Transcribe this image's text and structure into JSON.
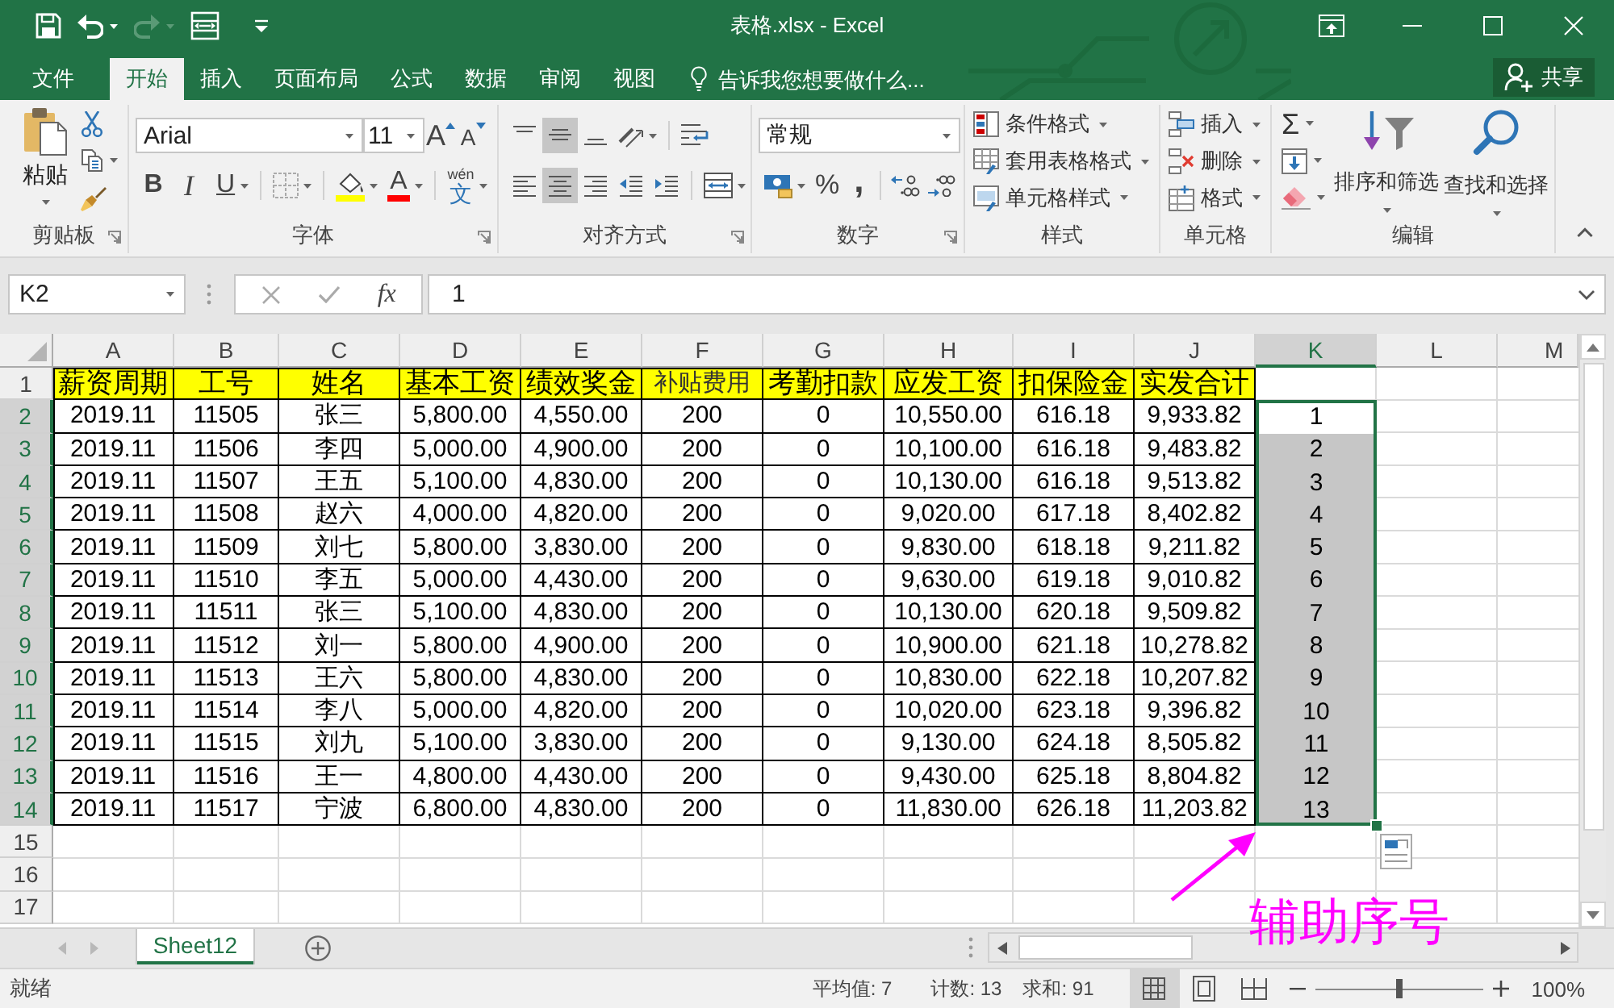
{
  "title_bar": {
    "title": "表格.xlsx - Excel"
  },
  "ribbon_tabs": [
    {
      "label": "文件",
      "selected": false
    },
    {
      "label": "开始",
      "selected": true
    },
    {
      "label": "插入",
      "selected": false
    },
    {
      "label": "页面布局",
      "selected": false
    },
    {
      "label": "公式",
      "selected": false
    },
    {
      "label": "数据",
      "selected": false
    },
    {
      "label": "审阅",
      "selected": false
    },
    {
      "label": "视图",
      "selected": false
    }
  ],
  "tell_me": {
    "placeholder": "告诉我您想要做什么..."
  },
  "share_button": {
    "label": "共享"
  },
  "clipboard": {
    "paste": "粘贴",
    "group_label": "剪贴板"
  },
  "font": {
    "font_name": "Arial",
    "font_size": "11",
    "grow": "A",
    "shrink": "A",
    "bold": "B",
    "italic": "I",
    "underline": "U",
    "font_color": "A",
    "phonetic_hint": "wén",
    "phonetic": "文",
    "group_label": "字体"
  },
  "alignment": {
    "vertical": [
      {
        "kind": "top",
        "selected": false
      },
      {
        "kind": "middle",
        "selected": true
      },
      {
        "kind": "bottom",
        "selected": false
      }
    ],
    "horizontal": [
      {
        "kind": "left",
        "selected": false
      },
      {
        "kind": "center",
        "selected": true
      },
      {
        "kind": "right",
        "selected": false
      }
    ],
    "group_label": "对齐方式"
  },
  "number": {
    "format": "常规",
    "percent": "%",
    "comma": ",",
    "group_label": "数字"
  },
  "styles": {
    "items": [
      {
        "kind": "conditional",
        "label": "条件格式"
      },
      {
        "kind": "table",
        "label": "套用表格格式"
      },
      {
        "kind": "cell",
        "label": "单元格样式"
      }
    ],
    "group_label": "样式"
  },
  "cells": {
    "items": [
      {
        "kind": "insert",
        "label": "插入"
      },
      {
        "kind": "delete",
        "label": "删除"
      },
      {
        "kind": "format",
        "label": "格式"
      }
    ],
    "group_label": "单元格"
  },
  "editing": {
    "sum": "Σ",
    "sort": "排序和筛选",
    "find": "查找和选择",
    "group_label": "编辑"
  },
  "formula_bar": {
    "name_box": "K2",
    "function_label": "fx",
    "value": "1"
  },
  "sheet": {
    "columns": [
      {
        "label": "A",
        "selected": false
      },
      {
        "label": "B",
        "selected": false
      },
      {
        "label": "C",
        "selected": false
      },
      {
        "label": "D",
        "selected": false
      },
      {
        "label": "E",
        "selected": false
      },
      {
        "label": "F",
        "selected": false
      },
      {
        "label": "G",
        "selected": false
      },
      {
        "label": "H",
        "selected": false
      },
      {
        "label": "I",
        "selected": false
      },
      {
        "label": "J",
        "selected": false
      },
      {
        "label": "K",
        "selected": true
      },
      {
        "label": "L",
        "selected": false
      },
      {
        "label": "M",
        "selected": false
      }
    ],
    "rows": [
      {
        "number": "1",
        "kind": "header",
        "selected": false,
        "active": false,
        "cells": [
          {
            "text": "薪资周期",
            "light": false
          },
          {
            "text": "工号",
            "light": false
          },
          {
            "text": "姓名",
            "light": false
          },
          {
            "text": "基本工资",
            "light": false
          },
          {
            "text": "绩效奖金",
            "light": false
          },
          {
            "text": "补贴费用",
            "light": true
          },
          {
            "text": "考勤扣款",
            "light": false
          },
          {
            "text": "应发工资",
            "light": false
          },
          {
            "text": "扣保险金",
            "light": false
          },
          {
            "text": "实发合计",
            "light": false
          }
        ]
      },
      {
        "number": "2",
        "kind": "data",
        "selected": true,
        "active": true,
        "cells": [
          "2019.11",
          "11505",
          "张三",
          "5,800.00",
          "4,550.00",
          "200",
          "0",
          "10,550.00",
          "616.18",
          "9,933.82",
          "1"
        ]
      },
      {
        "number": "3",
        "kind": "data",
        "selected": true,
        "active": false,
        "cells": [
          "2019.11",
          "11506",
          "李四",
          "5,000.00",
          "4,900.00",
          "200",
          "0",
          "10,100.00",
          "616.18",
          "9,483.82",
          "2"
        ]
      },
      {
        "number": "4",
        "kind": "data",
        "selected": true,
        "active": false,
        "cells": [
          "2019.11",
          "11507",
          "王五",
          "5,100.00",
          "4,830.00",
          "200",
          "0",
          "10,130.00",
          "616.18",
          "9,513.82",
          "3"
        ]
      },
      {
        "number": "5",
        "kind": "data",
        "selected": true,
        "active": false,
        "cells": [
          "2019.11",
          "11508",
          "赵六",
          "4,000.00",
          "4,820.00",
          "200",
          "0",
          "9,020.00",
          "617.18",
          "8,402.82",
          "4"
        ]
      },
      {
        "number": "6",
        "kind": "data",
        "selected": true,
        "active": false,
        "cells": [
          "2019.11",
          "11509",
          "刘七",
          "5,800.00",
          "3,830.00",
          "200",
          "0",
          "9,830.00",
          "618.18",
          "9,211.82",
          "5"
        ]
      },
      {
        "number": "7",
        "kind": "data",
        "selected": true,
        "active": false,
        "cells": [
          "2019.11",
          "11510",
          "李五",
          "5,000.00",
          "4,430.00",
          "200",
          "0",
          "9,630.00",
          "619.18",
          "9,010.82",
          "6"
        ]
      },
      {
        "number": "8",
        "kind": "data",
        "selected": true,
        "active": false,
        "cells": [
          "2019.11",
          "11511",
          "张三",
          "5,100.00",
          "4,830.00",
          "200",
          "0",
          "10,130.00",
          "620.18",
          "9,509.82",
          "7"
        ]
      },
      {
        "number": "9",
        "kind": "data",
        "selected": true,
        "active": false,
        "cells": [
          "2019.11",
          "11512",
          "刘一",
          "5,800.00",
          "4,900.00",
          "200",
          "0",
          "10,900.00",
          "621.18",
          "10,278.82",
          "8"
        ]
      },
      {
        "number": "10",
        "kind": "data",
        "selected": true,
        "active": false,
        "cells": [
          "2019.11",
          "11513",
          "王六",
          "5,800.00",
          "4,830.00",
          "200",
          "0",
          "10,830.00",
          "622.18",
          "10,207.82",
          "9"
        ]
      },
      {
        "number": "11",
        "kind": "data",
        "selected": true,
        "active": false,
        "cells": [
          "2019.11",
          "11514",
          "李八",
          "5,000.00",
          "4,820.00",
          "200",
          "0",
          "10,020.00",
          "623.18",
          "9,396.82",
          "10"
        ]
      },
      {
        "number": "12",
        "kind": "data",
        "selected": true,
        "active": false,
        "cells": [
          "2019.11",
          "11515",
          "刘九",
          "5,100.00",
          "3,830.00",
          "200",
          "0",
          "9,130.00",
          "624.18",
          "8,505.82",
          "11"
        ]
      },
      {
        "number": "13",
        "kind": "data",
        "selected": true,
        "active": false,
        "cells": [
          "2019.11",
          "11516",
          "王一",
          "4,800.00",
          "4,430.00",
          "200",
          "0",
          "9,430.00",
          "625.18",
          "8,804.82",
          "12"
        ]
      },
      {
        "number": "14",
        "kind": "data",
        "selected": true,
        "active": false,
        "cells": [
          "2019.11",
          "11517",
          "宁波",
          "6,800.00",
          "4,830.00",
          "200",
          "0",
          "11,830.00",
          "626.18",
          "11,203.82",
          "13"
        ]
      },
      {
        "number": "15",
        "kind": "blank",
        "selected": false,
        "active": false
      },
      {
        "number": "16",
        "kind": "blank",
        "selected": false,
        "active": false
      },
      {
        "number": "17",
        "kind": "blank",
        "selected": false,
        "active": false
      }
    ]
  },
  "sheet_tabs": [
    {
      "label": "Sheet12",
      "selected": true
    }
  ],
  "status_bar": {
    "status": "就绪",
    "average": "平均值: 7",
    "count": "计数: 13",
    "sum": "求和: 91",
    "views": [
      {
        "kind": "normal",
        "selected": true
      },
      {
        "kind": "page_layout",
        "selected": false
      },
      {
        "kind": "page_break",
        "selected": false
      }
    ],
    "zoom": {
      "level": 0.5,
      "reading": "100%"
    }
  },
  "annotation": {
    "label": "辅助序号"
  }
}
